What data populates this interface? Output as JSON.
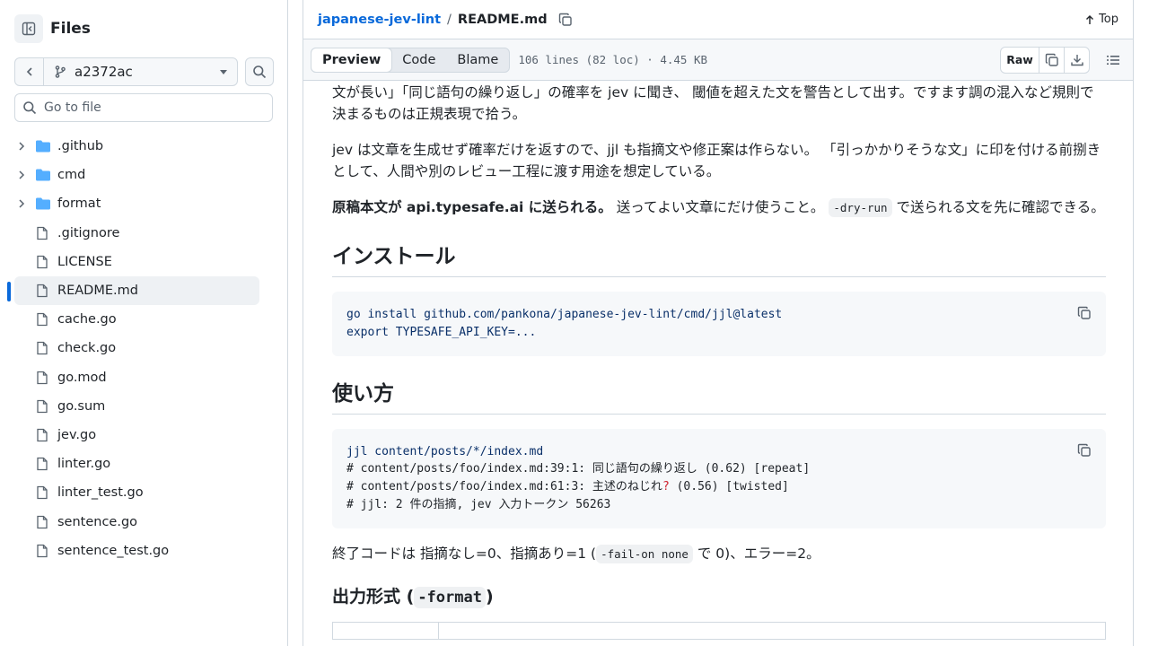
{
  "sidebar": {
    "title": "Files",
    "branch": "a2372ac",
    "goto_placeholder": "Go to file",
    "items": [
      {
        "label": ".github",
        "type": "folder"
      },
      {
        "label": "cmd",
        "type": "folder"
      },
      {
        "label": "format",
        "type": "folder"
      },
      {
        "label": ".gitignore",
        "type": "file"
      },
      {
        "label": "LICENSE",
        "type": "file"
      },
      {
        "label": "README.md",
        "type": "file",
        "active": true
      },
      {
        "label": "cache.go",
        "type": "file"
      },
      {
        "label": "check.go",
        "type": "file"
      },
      {
        "label": "go.mod",
        "type": "file"
      },
      {
        "label": "go.sum",
        "type": "file"
      },
      {
        "label": "jev.go",
        "type": "file"
      },
      {
        "label": "linter.go",
        "type": "file"
      },
      {
        "label": "linter_test.go",
        "type": "file"
      },
      {
        "label": "sentence.go",
        "type": "file"
      },
      {
        "label": "sentence_test.go",
        "type": "file"
      }
    ]
  },
  "header": {
    "repo": "japanese-jev-lint",
    "separator": "/",
    "file": "README.md",
    "top_label": "Top"
  },
  "toolbar": {
    "tabs": [
      "Preview",
      "Code",
      "Blame"
    ],
    "active_tab": "Preview",
    "file_info": "106 lines (82 loc) · 4.45 KB",
    "raw_label": "Raw"
  },
  "readme": {
    "p1": "文が長い」「同じ語句の繰り返し」の確率を jev に聞き、 閾値を超えた文を警告として出す。ですます調の混入など規則で決まるものは正規表現で拾う。",
    "p2": "jev は文章を生成せず確率だけを返すので、jjl も指摘文や修正案は作らない。 「引っかかりそうな文」に印を付ける前捌きとして、人間や別のレビュー工程に渡す用途を想定している。",
    "p3_bold": "原稿本文が api.typesafe.ai に送られる。",
    "p3_a": " 送ってよい文章にだけ使うこと。 ",
    "p3_code": "-dry-run",
    "p3_b": " で送られる文を先に確認できる。",
    "h_install": "インストール",
    "install_code": [
      "go install github.com/pankona/japanese-jev-lint/cmd/jjl@latest",
      "export TYPESAFE_API_KEY=..."
    ],
    "h_usage": "使い方",
    "usage_cmd": "jjl content/posts/*/index.md",
    "usage_line1": "# content/posts/foo/index.md:39:1: 同じ語句の繰り返し (0.62) [repeat]",
    "usage_line2a": "# content/posts/foo/index.md:61:3: 主述のねじれ",
    "usage_line2q": "?",
    "usage_line2b": " (0.56) [twisted]",
    "usage_line3": "# jjl: 2 件の指摘, jev 入力トークン 56263",
    "exit_a": "終了コードは 指摘なし=0、指摘あり=1 (",
    "exit_code": "-fail-on none",
    "exit_b": " で 0)、エラー=2。",
    "h_format_a": "出力形式 (",
    "h_format_code": "-format",
    "h_format_b": ")"
  }
}
